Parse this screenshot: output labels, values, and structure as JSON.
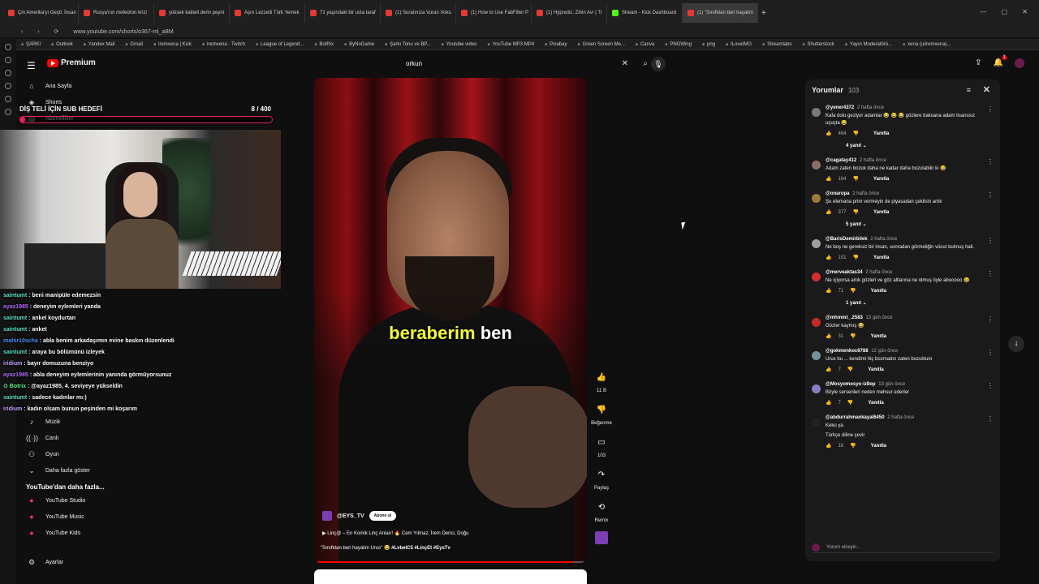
{
  "browser": {
    "tabs": [
      "Çin Amerika'yı Geçti: İnsan",
      "Rusya'nın mefedron krizi",
      "yüksek kaliteli derin peyni",
      "Aşırı Lezzetli Türk Yemek",
      "71 yaşındaki bir usta taraf",
      "(1) Suratınıza Vuran Voku",
      "(1) How to Use FabFilter P",
      "(1) Hypnotic: Zihin Avı | Tr",
      "Stream - Kick Dashboard",
      "(1) \"Sınıfktan beri hayalim"
    ],
    "url": "www.youtube.com/shorts/o367-ml_aBM",
    "bookmarks": [
      "ŞARKI",
      "Outlook",
      "Yandex Mail",
      "Gmail",
      "iremxena | Kick",
      "iremxena - Twitch",
      "League of Legend...",
      "BotRix",
      "ByNoGame",
      "Şarkı Tonu ve BP...",
      "Youtube video",
      "YouTube MP3 MP4",
      "Pixabay",
      "Green Screen Me...",
      "Canva",
      "PNGWing",
      "png",
      "ILoveIMG",
      "Streamlabs",
      "Shutterstock",
      "Yayın Moderatörü...",
      "xena (u/iremxena)..."
    ]
  },
  "youtube": {
    "logo": "Premium",
    "search_value": "orkun",
    "sidebar": {
      "items": [
        {
          "icon": "⌂",
          "label": "Ana Sayfa"
        },
        {
          "icon": "◈",
          "label": "Shorts"
        },
        {
          "icon": "▤",
          "label": "Abonelikler"
        }
      ],
      "lower": [
        {
          "icon": "♪",
          "label": "Müzik"
        },
        {
          "icon": "((·))",
          "label": "Canlı"
        },
        {
          "icon": "⚇",
          "label": "Oyun"
        },
        {
          "icon": "⌄",
          "label": "Daha fazla göster"
        }
      ],
      "more_head": "YouTube'dan daha fazla...",
      "more": [
        "YouTube Studio",
        "YouTube Music",
        "YouTube Kids"
      ],
      "settings": "Ayarlar"
    }
  },
  "overlay": {
    "goal_title": "DİŞ TELİ İÇİN SUB HEDEFİ",
    "goal_count": "8  / 400",
    "goal_progress": 0.02,
    "chat": [
      {
        "user": "saintumt",
        "msg": ": beni manipüle edemezsin",
        "c": "u1"
      },
      {
        "user": "ayaz1985",
        "msg": ": deneyim eylemleri yanda",
        "c": "u2"
      },
      {
        "user": "saintumt",
        "msg": ": ankel koydurtan",
        "c": "u1"
      },
      {
        "user": "saintumt",
        "msg": ": anket",
        "c": "u1"
      },
      {
        "user": "mahir10scha",
        "msg": ": abla benim arkadaşımın evine baskın düzenlendi",
        "c": "u3"
      },
      {
        "user": "saintumt",
        "msg": ": araya bu bölümünü izleyek",
        "c": "u1"
      },
      {
        "user": "iridium",
        "msg": ": bayır domuzuna benziyo",
        "c": "u5"
      },
      {
        "user": "ayaz1985",
        "msg": ": abla deneyim eylemlerinin yanında görmüyorsunuz",
        "c": "u2"
      },
      {
        "user": "⊙ Botrix",
        "msg": ": @ayaz1985, 4. seviyeye yükseldin",
        "c": "u4"
      },
      {
        "user": "saintumt",
        "msg": ": sadece kadınlar mı:)",
        "c": "u1"
      },
      {
        "user": "iridium",
        "msg": ": kadın olsam bunun peşinden mi koşarım",
        "c": "u5"
      }
    ]
  },
  "short": {
    "caption_word1": "beraberim",
    "caption_word2": "ben",
    "channel": "@EYS_TV",
    "subscribe": "Abone ol",
    "related": "▶ Linç@ – En Komik Linç Anları! 🔥 Cem Yılmaz, İrem Derici, Doğu",
    "title": "\"Sınıfktan beri hayalim Urus\" 😂",
    "tags": "#LvbelC5 #LinçEt #EysTv",
    "progress": 0.95,
    "actions": [
      {
        "name": "like",
        "icon": "👍",
        "label": "11 B"
      },
      {
        "name": "dislike",
        "icon": "👎",
        "label": "Beğenme"
      },
      {
        "name": "comments",
        "icon": "▭",
        "label": "103"
      },
      {
        "name": "share",
        "icon": "↷",
        "label": "Paylaş"
      },
      {
        "name": "remix",
        "icon": "⟲",
        "label": "Remix"
      }
    ]
  },
  "comments": {
    "title": "Yorumlar",
    "count": "103",
    "items": [
      {
        "user": "@yener4372",
        "time": "2 hafta önce",
        "text": "Kafa dolu geziyor adamlar 😂 😂 😂 gözlere baksana adam lisanssız uçuşta 😂",
        "likes": "464",
        "color": "#7a7a7a",
        "replies": "4 yanıt"
      },
      {
        "user": "@cagatay412",
        "time": "2 hafta önce",
        "text": "Adam zaten bozuk daha ne kadar daha bozulabilir ki 😂",
        "likes": "164",
        "color": "#8d6e63",
        "replies": ""
      },
      {
        "user": "@onaropa",
        "time": "2 hafta önce",
        "text": "Şu elemana prim vermeyin de piyasadan çekilsin artık",
        "likes": "377",
        "color": "#a07a3a",
        "replies": "5 yanıt"
      },
      {
        "user": "@BarisDemirbilek",
        "time": "2 hafta önce",
        "text": "Ne boş ne gereksiz bir insan, sonradan görmeliğin vücut bulmuş hali.",
        "likes": "101",
        "color": "#9e9e9e",
        "replies": ""
      },
      {
        "user": "@merveaktas34",
        "time": "2 hafta önce",
        "text": "Ne içiyorsa artık gözleri ve göz altlarına ne olmuş öyle abooooo 😂",
        "likes": "71",
        "color": "#d32f2f",
        "replies": "1 yanıt"
      },
      {
        "user": "@mhmmt_.2583",
        "time": "13 gün önce",
        "text": "Gözler kaymış 😂",
        "likes": "31",
        "color": "#c62828",
        "replies": ""
      },
      {
        "user": "@gokmenkoc6788",
        "time": "12 gün önce",
        "text": "Urus bu ... kendimi hiç bozmadın zaten bozuktum",
        "likes": "7",
        "color": "#78909c",
        "replies": ""
      },
      {
        "user": "@Mosyomosyo-iz8op",
        "time": "13 gün önce",
        "text": "Böyle serserileri neden mehsur ederler",
        "likes": "7",
        "color": "#8e7cc3",
        "replies": ""
      },
      {
        "user": "@abdurrahmankayal6450",
        "time": "2 hafta önce",
        "text": "Keko ya",
        "likes": "16",
        "color": "#222222",
        "replies": "",
        "translate": "Türkçe diline çevir"
      }
    ],
    "reply_label": "Yanıtla",
    "input_placeholder": "Yorum ekleyin..."
  }
}
